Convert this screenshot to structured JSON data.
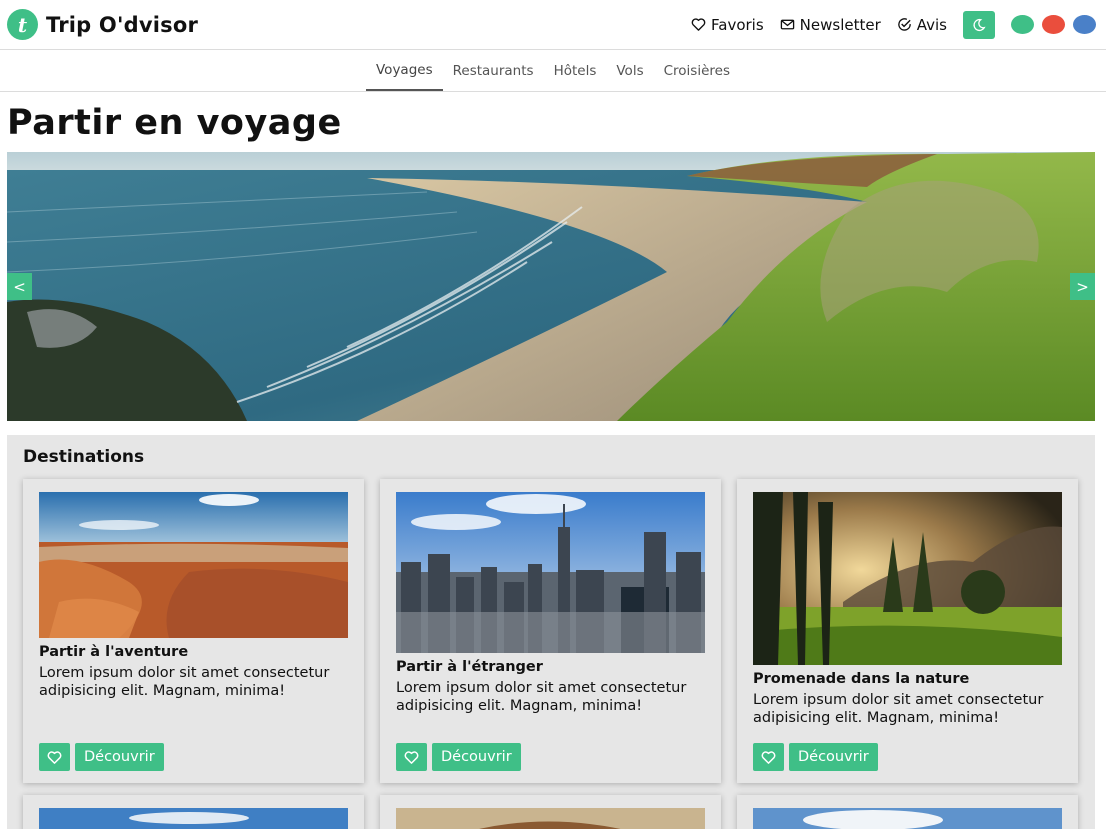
{
  "brand": {
    "logo_letter": "t",
    "name": "Trip O'dvisor"
  },
  "top_links": [
    {
      "label": "Favoris",
      "icon": "heart-icon"
    },
    {
      "label": "Newsletter",
      "icon": "mail-icon"
    },
    {
      "label": "Avis",
      "icon": "check-circle-icon"
    }
  ],
  "theme_toggle": {
    "icon": "moon-icon"
  },
  "color_swatches": [
    "#3fbf87",
    "#ea4e3d",
    "#4a80c8"
  ],
  "tabs": [
    {
      "label": "Voyages",
      "active": true
    },
    {
      "label": "Restaurants",
      "active": false
    },
    {
      "label": "Hôtels",
      "active": false
    },
    {
      "label": "Vols",
      "active": false
    },
    {
      "label": "Croisières",
      "active": false
    }
  ],
  "page_title": "Partir en voyage",
  "carousel": {
    "prev": "<",
    "next": ">"
  },
  "destinations": {
    "title": "Destinations",
    "cards": [
      {
        "title": "Partir à l'aventure",
        "text": "Lorem ipsum dolor sit amet consectetur adipisicing elit. Magnam, minima!",
        "button": "Découvrir"
      },
      {
        "title": "Partir à l'étranger",
        "text": "Lorem ipsum dolor sit amet consectetur adipisicing elit. Magnam, minima!",
        "button": "Découvrir"
      },
      {
        "title": "Promenade dans la nature",
        "text": "Lorem ipsum dolor sit amet consectetur adipisicing elit. Magnam, minima!",
        "button": "Découvrir"
      }
    ]
  },
  "colors": {
    "accent": "#3fbf87",
    "section_bg": "#e6e6e6"
  }
}
